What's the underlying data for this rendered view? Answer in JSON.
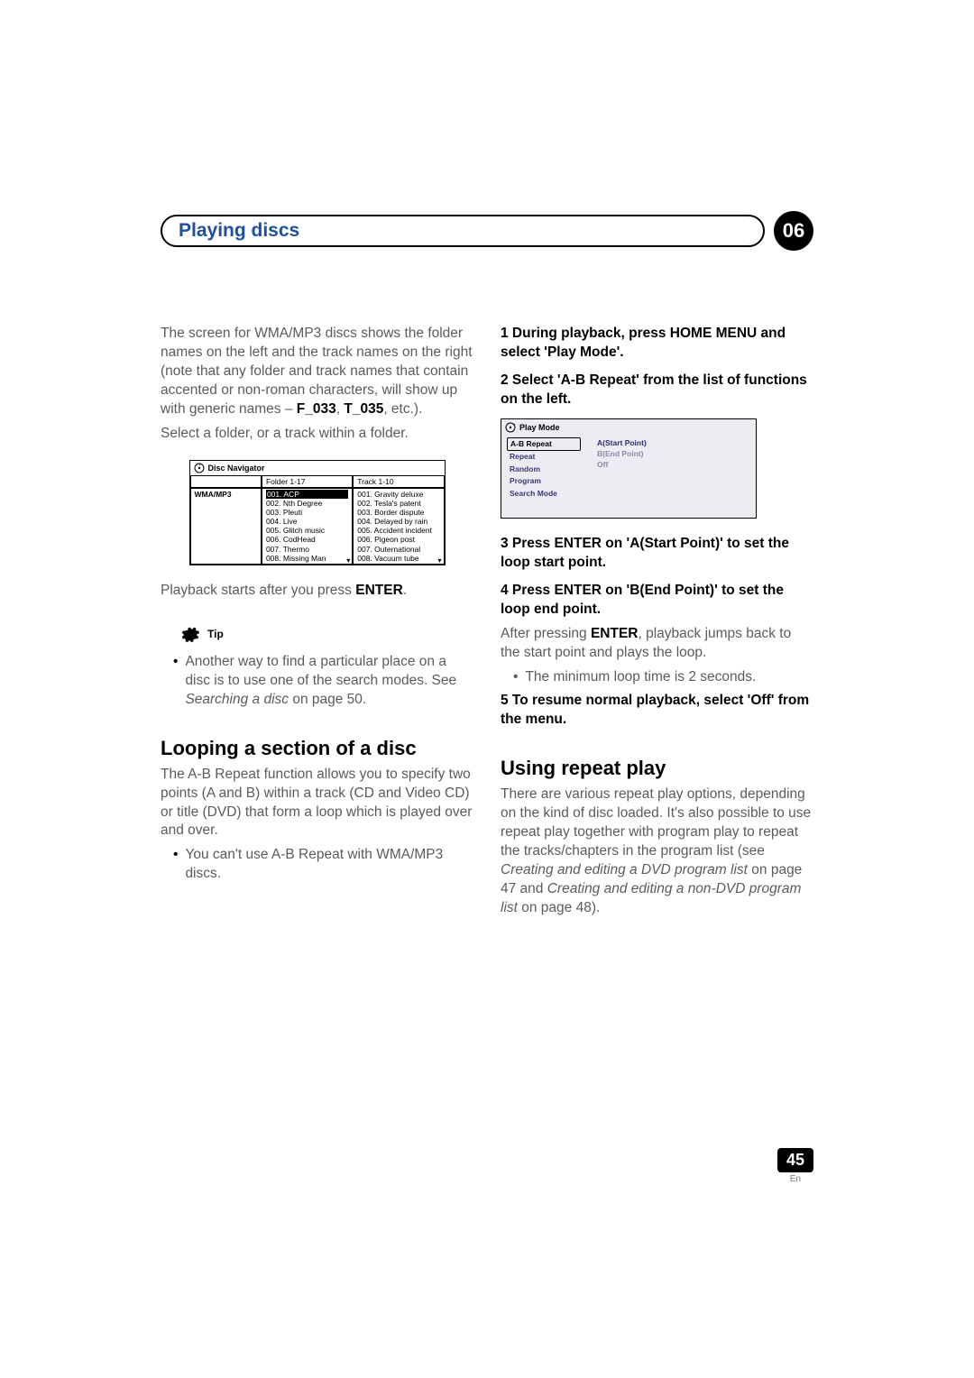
{
  "header": {
    "title": "Playing discs",
    "chapter_number": "06"
  },
  "left": {
    "intro": "The screen for WMA/MP3 discs shows the folder names on the left and the track names on the right (note that any folder and track names that contain accented or non-roman characters, will show up with generic names – ",
    "intro_bold1": "F_033",
    "intro_sep": ", ",
    "intro_bold2": "T_035",
    "intro_end": ", etc.).",
    "select_line": "Select a folder, or a track within a folder.",
    "disc_nav": {
      "title": "Disc Navigator",
      "left_header": "",
      "mid_header": "Folder 1-17",
      "right_header": "Track 1-10",
      "left_cell": "WMA/MP3",
      "folders": [
        "001. ACP",
        "002. Nth Degree",
        "003. Pleuti",
        "004. Live",
        "005. Glitch music",
        "006. CodHead",
        "007. Thermo",
        "008. Missing Man"
      ],
      "tracks": [
        "001. Gravity deluxe",
        "002. Tesla's patent",
        "003. Border dispute",
        "004. Delayed by rain",
        "005. Accident incident",
        "006. Pigeon post",
        "007. Outernational",
        "008. Vacuum tube"
      ]
    },
    "playback_a": "Playback starts after you press ",
    "playback_b": "ENTER",
    "playback_c": ".",
    "tip_label": "Tip",
    "tip_bullet_a": "Another way to find a particular place on a disc is to use one of the search modes. See ",
    "tip_bullet_i": "Searching a disc",
    "tip_bullet_b": " on page 50.",
    "h2": "Looping a section of a disc",
    "loop_para": "The A-B Repeat function allows you to specify two points (A and B) within a track (CD and Video CD) or title (DVD) that form a loop which is played over and over.",
    "loop_bullet": "You can't use A-B Repeat with WMA/MP3 discs."
  },
  "right": {
    "step1": "1    During playback, press HOME MENU and select 'Play Mode'.",
    "step2": "2    Select 'A-B Repeat' from the list of functions on the left.",
    "play_mode": {
      "title": "Play Mode",
      "left_items": [
        "A-B Repeat",
        "Repeat",
        "Random",
        "Program",
        "Search Mode"
      ],
      "right_items": [
        "A(Start Point)",
        "B(End Point)",
        "Off"
      ]
    },
    "step3": "3    Press ENTER on 'A(Start Point)' to set the loop start point.",
    "step4": "4    Press ENTER on 'B(End Point)' to set the loop end point.",
    "after_a": "After pressing ",
    "after_b": "ENTER",
    "after_c": ", playback jumps back to the start point and plays the loop.",
    "min_bullet": "The minimum loop time is 2 seconds.",
    "step5": "5    To resume normal playback, select 'Off' from the menu.",
    "h2": "Using repeat play",
    "repeat_para_a": "There are various repeat play options, depending on the kind of disc loaded. It's also possible to use repeat play together with program play to repeat the tracks/chapters in the program list (see ",
    "repeat_para_i1": "Creating and editing a DVD program list",
    "repeat_para_b": " on page 47 and ",
    "repeat_para_i2": "Creating and editing a non-DVD program list",
    "repeat_para_c": " on page 48)."
  },
  "footer": {
    "page": "45",
    "lang": "En"
  }
}
